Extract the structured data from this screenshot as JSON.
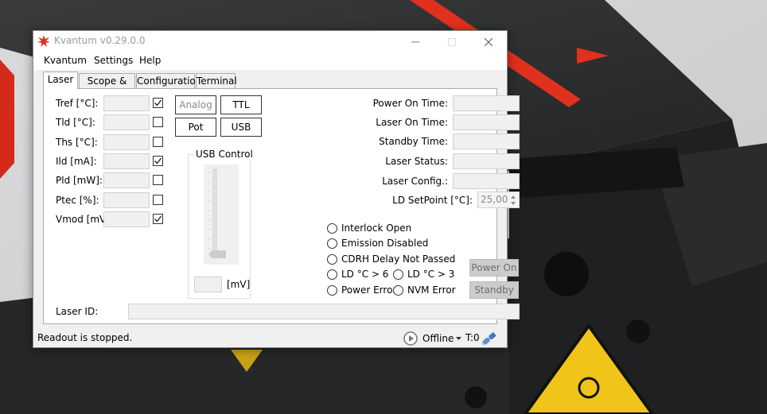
{
  "window": {
    "title": "Kvantum v0.29.0.0"
  },
  "menu": [
    "Kvantum",
    "Settings",
    "Help"
  ],
  "tabs": [
    "Laser",
    "Scope & Log",
    "Configuration",
    "Terminal"
  ],
  "readouts": [
    {
      "label": "Tref [°C]:",
      "checked": true
    },
    {
      "label": "Tld [°C]:",
      "checked": false
    },
    {
      "label": "Ths [°C]:",
      "checked": false
    },
    {
      "label": "Ild [mA]:",
      "checked": true
    },
    {
      "label": "Pld [mW]:",
      "checked": false
    },
    {
      "label": "Ptec [%]:",
      "checked": false
    },
    {
      "label": "Vmod [mV]:",
      "checked": true
    }
  ],
  "mode_buttons": {
    "analog": "Analog",
    "ttl": "TTL",
    "pot": "Pot",
    "usb": "USB"
  },
  "usb_control": {
    "title": "USB Control",
    "unit": "[mV]",
    "value": ""
  },
  "info": {
    "power_on_time": "Power On Time:",
    "laser_on_time": "Laser On Time:",
    "standby_time": "Standby Time:",
    "laser_status": "Laser Status:",
    "laser_config": "Laser Config.:",
    "ld_setpoint": "LD SetPoint [°C]:",
    "ld_setpoint_value": "25,00"
  },
  "indicators": {
    "interlock_open": "Interlock Open",
    "emission_disabled": "Emission Disabled",
    "cdrh_delay": "CDRH Delay Not Passed",
    "ld_gt6": "LD °C > 6",
    "ld_gt3": "LD °C > 3",
    "power_error": "Power Error",
    "nvm_error": "NVM Error"
  },
  "actions": {
    "power_on": "Power On",
    "standby": "Standby"
  },
  "laser_id": {
    "label": "Laser ID:",
    "value": ""
  },
  "status": {
    "readout": "Readout is stopped.",
    "connection": "Offline",
    "counter": "T:0"
  },
  "colors": {
    "accent": "#e0301e",
    "photo_dark": "#2b2c2e"
  }
}
